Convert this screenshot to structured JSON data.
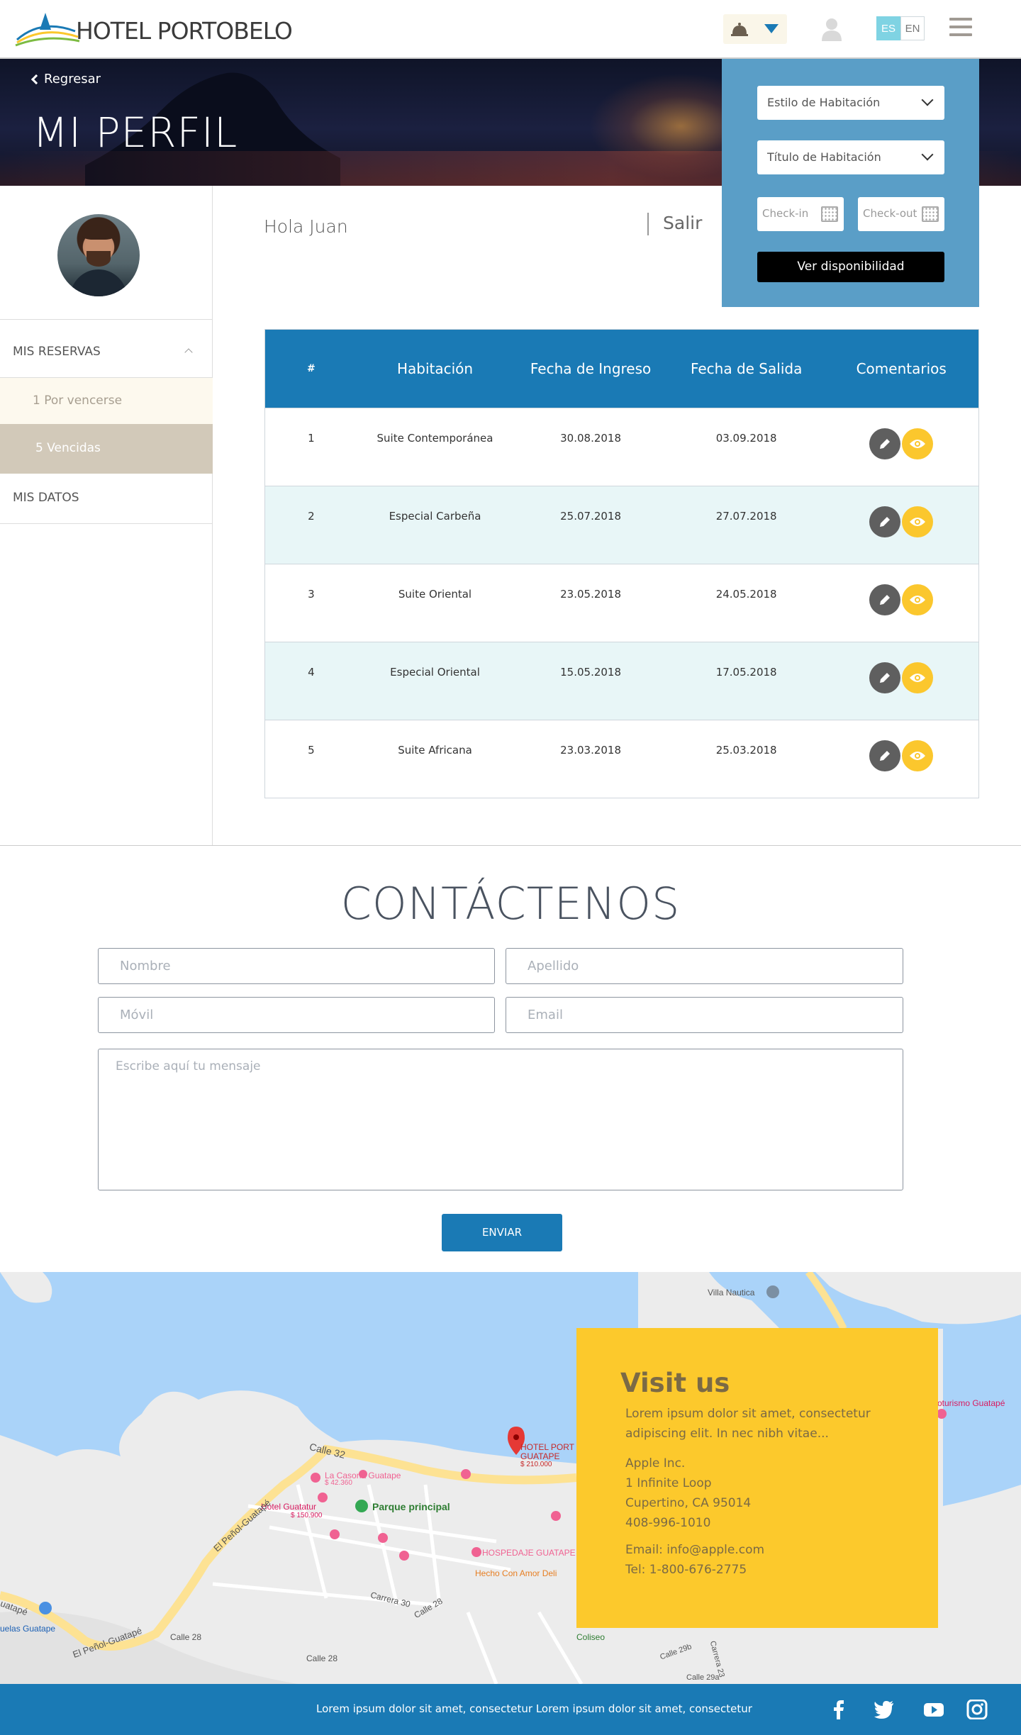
{
  "header": {
    "logo_text": "HOTEL PORTOBELO",
    "lang_es": "ES",
    "lang_en": "EN"
  },
  "hero": {
    "back_label": "Regresar",
    "title": "MI PERFIL"
  },
  "booking": {
    "room_style_placeholder": "Estilo de Habitación",
    "room_title_placeholder": "Título de Habitación",
    "checkin_placeholder": "Check-in",
    "checkout_placeholder": "Check-out",
    "submit_label": "Ver disponibilidad"
  },
  "sidebar": {
    "section_reservas": "MIS RESERVAS",
    "sub_pending": "1 Por vencerse",
    "sub_expired": "5 Vencidas",
    "section_datos": "MIS DATOS"
  },
  "greeting": "Hola Juan",
  "logout_label": "Salir",
  "table": {
    "headers": [
      "#",
      "Habitación",
      "Fecha de Ingreso",
      "Fecha de Salida",
      "Comentarios"
    ],
    "rows": [
      {
        "num": "1",
        "room": "Suite Contemporánea",
        "checkin": "30.08.2018",
        "checkout": "03.09.2018"
      },
      {
        "num": "2",
        "room": "Especial Carbeña",
        "checkin": "25.07.2018",
        "checkout": "27.07.2018"
      },
      {
        "num": "3",
        "room": "Suite Oriental",
        "checkin": "23.05.2018",
        "checkout": "24.05.2018"
      },
      {
        "num": "4",
        "room": "Especial Oriental",
        "checkin": "15.05.2018",
        "checkout": "17.05.2018"
      },
      {
        "num": "5",
        "room": "Suite Africana",
        "checkin": "23.03.2018",
        "checkout": "25.03.2018"
      }
    ]
  },
  "contact": {
    "title": "CONTÁCTENOS",
    "name_placeholder": "Nombre",
    "lastname_placeholder": "Apellido",
    "mobile_placeholder": "Móvil",
    "email_placeholder": "Email",
    "message_placeholder": "Escribe aquí tu mensaje",
    "submit_label": "ENVIAR"
  },
  "map": {
    "labels": {
      "villa_nautica": "Villa Nautica",
      "turismo": "oturismo Guatapé",
      "calle32": "Calle 32",
      "la_casona": "La Casona Guatape",
      "la_casona_price": "$ 42.360",
      "hotel_port": "HOTEL PORT",
      "guatape": "GUATAPE",
      "hotel_price": "$ 210.000",
      "parque": "Parque principal",
      "hotel_guatatur": "Hotel Guatatur",
      "guatatur_price": "$ 150.900",
      "penol1": "El Peñol-Guatapé",
      "penol2": "El Peñol-Guatapé",
      "hospedaje": "HOSPEDAJE GUATAPE",
      "hecho": "Hecho Con Amor Deli",
      "carrera30": "Carrera 30",
      "calle28a": "Calle 28",
      "calle28b": "Calle 28",
      "calle28c": "Calle 28",
      "escuelas": "uelas Guatape",
      "coliseo": "Coliseo",
      "calle29b": "Calle 29b",
      "carrera23": "Carrera 23",
      "calle29a": "Calle 29a",
      "guatape_left": "uatapé"
    }
  },
  "visit": {
    "title": "Visit us",
    "desc": "Lorem ipsum dolor sit amet, consectetur adipiscing elit. In nec nibh vitae...",
    "company": "Apple Inc.",
    "address1": "1 Infinite Loop",
    "address2": "Cupertino, CA 95014",
    "phone": "408-996-1010",
    "email": "Email: info@apple.com",
    "tel": "Tel: 1-800-676-2775"
  },
  "footer": {
    "text": "Lorem ipsum dolor sit amet, consectetur Lorem ipsum dolor sit amet, consectetur"
  },
  "colors": {
    "primary": "#1a7ab5",
    "accent_yellow": "#fcc92c",
    "booking_panel": "#5a9ec7"
  }
}
